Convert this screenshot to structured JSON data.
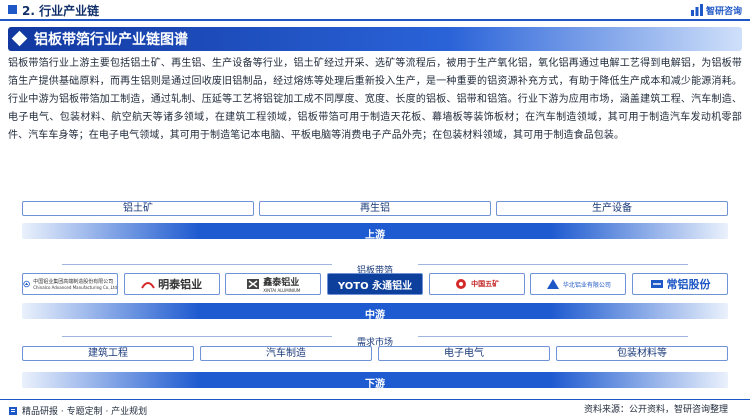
{
  "header": {
    "section": "2. 行业产业链",
    "brand": "智研咨询"
  },
  "title": "铝板带箔行业产业链图谱",
  "paragraph": "铝板带箔行业上游主要包括铝土矿、再生铝、生产设备等行业，铝土矿经过开采、选矿等流程后，被用于生产氧化铝，氧化铝再通过电解工艺得到电解铝，为铝板带箔生产提供基础原料，而再生铝则是通过回收废旧铝制品，经过熔炼等处理后重新投入生产，是一种重要的铝资源补充方式，有助于降低生产成本和减少能源消耗。行业中游为铝板带箔加工制造，通过轧制、压延等工艺将铝锭加工成不同厚度、宽度、长度的铝板、铝带和铝箔。行业下游为应用市场，涵盖建筑工程、汽车制造、电子电气、包装材料、航空航天等诸多领域，在建筑工程领域，铝板带箔可用于制造天花板、幕墙板等装饰板材；在汽车制造领域，其可用于制造汽车发动机零部件、汽车车身等；在电子电气领域，其可用于制造笔记本电脑、平板电脑等消费电子产品外壳；在包装材料领域，其可用于制造食品包装。",
  "upstream": {
    "items": [
      "铝土矿",
      "再生铝",
      "生产设备"
    ],
    "band": "上游"
  },
  "midstream": {
    "header": "铝板带箔",
    "companies": [
      {
        "name": "中国铝业集团高端制造股份有限公司",
        "sub": "Chinalco Advanced Manufacturing Co.,Ltd",
        "icon": "chinalco-logo"
      },
      {
        "name": "明泰铝业",
        "sub": "",
        "icon": "mingtai-logo"
      },
      {
        "name": "鑫泰铝业",
        "sub": "XINTAI ALUMINIUM",
        "icon": "xintai-logo"
      },
      {
        "name": "YOTO 永通铝业",
        "sub": "",
        "icon": "yoto-logo"
      },
      {
        "name": "中国五矿",
        "sub": "",
        "icon": "minmetals-logo"
      },
      {
        "name": "华北铝业有限公司",
        "sub": "",
        "icon": "huabei-logo"
      },
      {
        "name": "常铝股份",
        "sub": "",
        "icon": "changlv-logo"
      }
    ],
    "band": "中游"
  },
  "downstream": {
    "header": "需求市场",
    "items": [
      "建筑工程",
      "汽车制造",
      "电子电气",
      "包装材料等"
    ],
    "band": "下游"
  },
  "footer": {
    "left": "精品研报 · 专题定制 · 产业规划",
    "right": "资料来源：公开资料，智研咨询整理"
  },
  "colors": {
    "primary": "#1e57c6",
    "dark": "#12306a",
    "border": "#6f93d6"
  }
}
